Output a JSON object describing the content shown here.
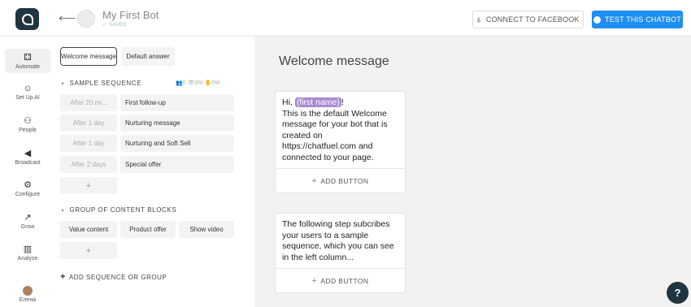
{
  "header": {
    "bot_name": "My First Bot",
    "saved_status": "✓ SAVED",
    "connect_label": "CONNECT TO FACEBOOK",
    "test_label": "TEST THIS CHATBOT"
  },
  "nav": {
    "items": [
      {
        "label": "Automate",
        "icon": "automate-icon",
        "glyph": "⚃"
      },
      {
        "label": "Set Up AI",
        "icon": "ai-icon",
        "glyph": "☺"
      },
      {
        "label": "People",
        "icon": "people-icon",
        "glyph": "⚇"
      },
      {
        "label": "Broadcast",
        "icon": "megaphone-icon",
        "glyph": "◀"
      },
      {
        "label": "Configure",
        "icon": "gear-icon",
        "glyph": "⚙"
      },
      {
        "label": "Grow",
        "icon": "grow-icon",
        "glyph": "↗"
      },
      {
        "label": "Analyze",
        "icon": "chart-icon",
        "glyph": "▥"
      }
    ],
    "user_label": "Елена"
  },
  "panel": {
    "tabs": [
      "Welcome message",
      "Default answer"
    ],
    "sequence_title": "SAMPLE SEQUENCE",
    "stats": "👥0  👁0%  ✋0%",
    "sequence": [
      {
        "delay": "After 20 mi...",
        "name": "First follow-up"
      },
      {
        "delay": "After 1 day",
        "name": "Nurturing message"
      },
      {
        "delay": "After 1 day",
        "name": "Nurturing and Soft Sell"
      },
      {
        "delay": "After 2 days",
        "name": "Special offer"
      }
    ],
    "plus": "+",
    "group_title": "GROUP OF CONTENT BLOCKS",
    "group_blocks": [
      "Value content",
      "Product offer",
      "Show video"
    ],
    "add_sequence": "ADD SEQUENCE OR GROUP"
  },
  "canvas": {
    "title": "Welcome message",
    "card1": {
      "greeting": "Hi,",
      "first_name": "{first name}",
      "exclaim": "!",
      "body": "This is the default Welcome message for your bot that is created on https://chatfuel.com and connected to your page."
    },
    "card2": {
      "body": "The following step subcribes your users to a sample sequence, which you can see in the left column..."
    },
    "add_button": "ADD BUTTON",
    "help": "?"
  }
}
